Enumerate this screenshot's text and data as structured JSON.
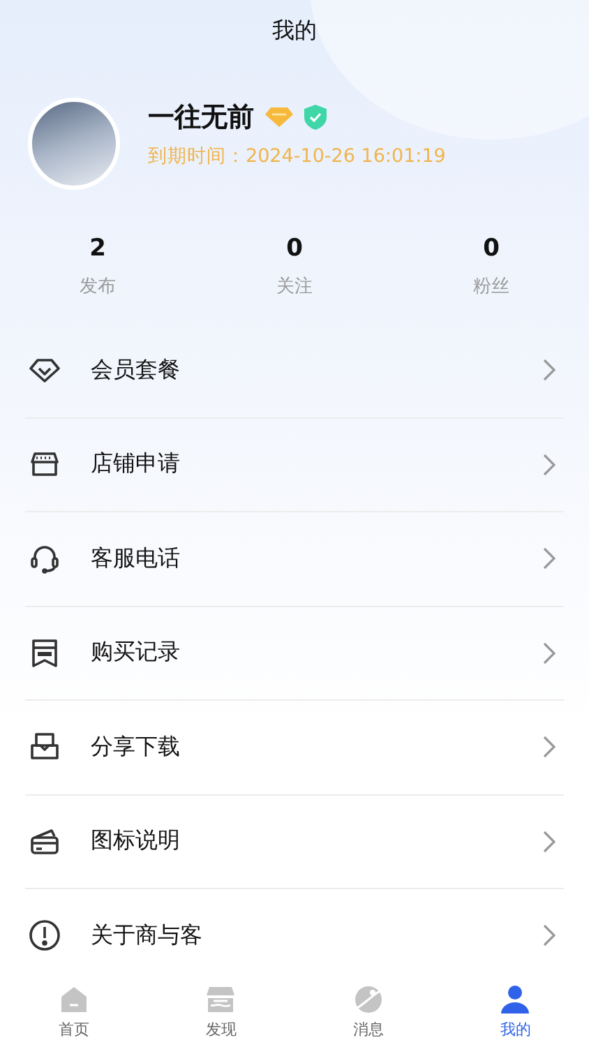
{
  "title": "我的",
  "profile": {
    "name": "一往无前",
    "expiry": "到期时间：2024-10-26 16:01:19"
  },
  "stats": [
    {
      "value": "2",
      "label": "发布"
    },
    {
      "value": "0",
      "label": "关注"
    },
    {
      "value": "0",
      "label": "粉丝"
    }
  ],
  "menu": [
    {
      "kind": "diamond",
      "label": "会员套餐"
    },
    {
      "kind": "shop",
      "label": "店铺申请"
    },
    {
      "kind": "headset",
      "label": "客服电话"
    },
    {
      "kind": "receipt",
      "label": "购买记录"
    },
    {
      "kind": "inbox",
      "label": "分享下载"
    },
    {
      "kind": "card",
      "label": "图标说明"
    },
    {
      "kind": "info",
      "label": "关于商与客"
    }
  ],
  "tabs": [
    {
      "kind": "home",
      "label": "首页",
      "selected": false
    },
    {
      "kind": "shop",
      "label": "发现",
      "selected": false
    },
    {
      "kind": "planet",
      "label": "消息",
      "selected": false
    },
    {
      "kind": "person",
      "label": "我的",
      "selected": true
    }
  ]
}
